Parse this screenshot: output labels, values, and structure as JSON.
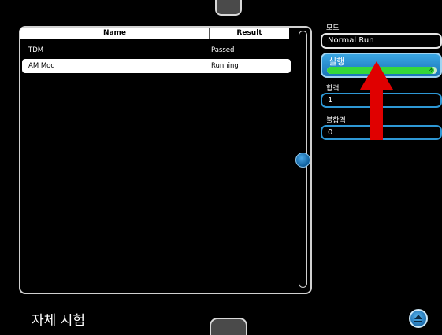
{
  "table": {
    "headers": {
      "name": "Name",
      "result": "Result"
    },
    "rows": [
      {
        "name": "TDM",
        "result": "Passed"
      },
      {
        "name": "AM Mod",
        "result": "Running"
      }
    ],
    "selected_row": 1
  },
  "side_panel": {
    "mode": {
      "label": "모드",
      "value": "Normal Run"
    },
    "run": {
      "label": "실행",
      "progress_text": "초",
      "progress_fraction": 0.97
    },
    "pass": {
      "label": "합격",
      "value": "1"
    },
    "fail": {
      "label": "불합격",
      "value": "0"
    }
  },
  "footer": {
    "title": "자체 시험"
  },
  "icons": {
    "scroll_thumb": "scroll-thumb-icon",
    "collapse": "collapse-up-icon",
    "annotation": "red-arrow-icon"
  },
  "colors": {
    "accent": "#2e98d5",
    "progress": "#35d83a",
    "annotation_arrow": "#e00000"
  }
}
